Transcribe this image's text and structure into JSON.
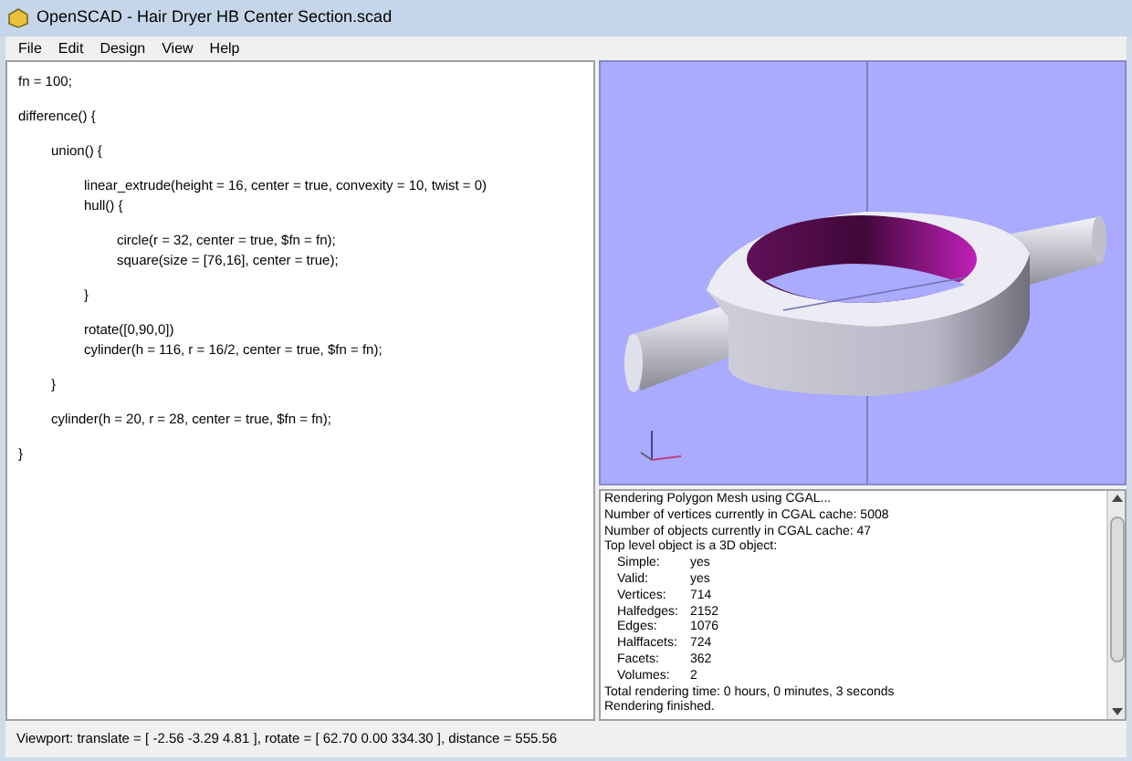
{
  "window": {
    "title": "OpenSCAD - Hair Dryer HB Center Section.scad"
  },
  "menu": [
    "File",
    "Edit",
    "Design",
    "View",
    "Help"
  ],
  "editor": {
    "lines": [
      {
        "kind": "code",
        "text": "fn = 100;"
      },
      {
        "kind": "blank"
      },
      {
        "kind": "code",
        "text": "difference() {",
        "children": [
          {
            "kind": "blank"
          },
          {
            "kind": "code",
            "text": "union() {",
            "children": [
              {
                "kind": "blank"
              },
              {
                "kind": "code",
                "text": "linear_extrude(height = 16, center = true, convexity = 10, twist = 0)"
              },
              {
                "kind": "code",
                "text": "hull() {",
                "children": [
                  {
                    "kind": "blank"
                  },
                  {
                    "kind": "code",
                    "text": "circle(r = 32, center = true, $fn = fn);"
                  },
                  {
                    "kind": "code",
                    "text": "square(size = [76,16], center = true);"
                  }
                ]
              },
              {
                "kind": "blank"
              },
              {
                "kind": "code",
                "text": "}"
              },
              {
                "kind": "blank"
              },
              {
                "kind": "code",
                "text": "rotate([0,90,0])"
              },
              {
                "kind": "code",
                "text": "cylinder(h = 116, r = 16/2, center = true, $fn = fn);"
              }
            ]
          },
          {
            "kind": "blank"
          },
          {
            "kind": "code",
            "text": "}"
          },
          {
            "kind": "blank"
          },
          {
            "kind": "code",
            "text": "cylinder(h = 20, r = 28, center = true, $fn = fn);"
          }
        ]
      },
      {
        "kind": "blank"
      },
      {
        "kind": "code",
        "text": "}"
      }
    ]
  },
  "console": {
    "lines": [
      {
        "text": "Rendering Polygon Mesh using CGAL..."
      },
      {
        "text": "Number of vertices currently in CGAL cache: 5008"
      },
      {
        "text": "Number of objects currently in CGAL cache: 47"
      },
      {
        "text": "Top level object is a 3D object:",
        "children": [
          {
            "label": "Simple:",
            "value": "yes"
          },
          {
            "label": "Valid:",
            "value": "yes"
          },
          {
            "label": "Vertices:",
            "value": "714"
          },
          {
            "label": "Halfedges:",
            "value": "2152"
          },
          {
            "label": "Edges:",
            "value": "1076"
          },
          {
            "label": "Halffacets:",
            "value": "724"
          },
          {
            "label": "Facets:",
            "value": "362"
          },
          {
            "label": "Volumes:",
            "value": "2"
          }
        ]
      },
      {
        "text": "Total rendering time: 0 hours, 0 minutes, 3 seconds"
      },
      {
        "text": "Rendering finished."
      }
    ]
  },
  "status_bar": "Viewport: translate = [ -2.56 -3.29 4.81 ], rotate = [ 62.70 0.00 334.30 ], distance = 555.56"
}
